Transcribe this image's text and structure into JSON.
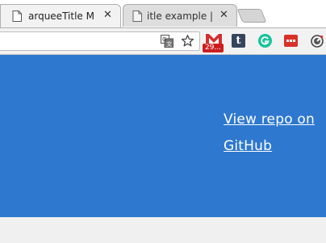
{
  "tabs": [
    {
      "title": "arqueeTitle M",
      "active": true
    },
    {
      "title": "itle example |",
      "active": false
    }
  ],
  "extensions": {
    "gmail_badge": "29..."
  },
  "hero": {
    "link_text": "View repo on GitHub",
    "background": "#2e78cf"
  },
  "icons": [
    "page-icon",
    "close-icon",
    "translate-icon",
    "star-icon",
    "gmail-icon",
    "tumblr-icon",
    "grammarly-icon",
    "menu-dots-icon",
    "tracker-icon"
  ]
}
